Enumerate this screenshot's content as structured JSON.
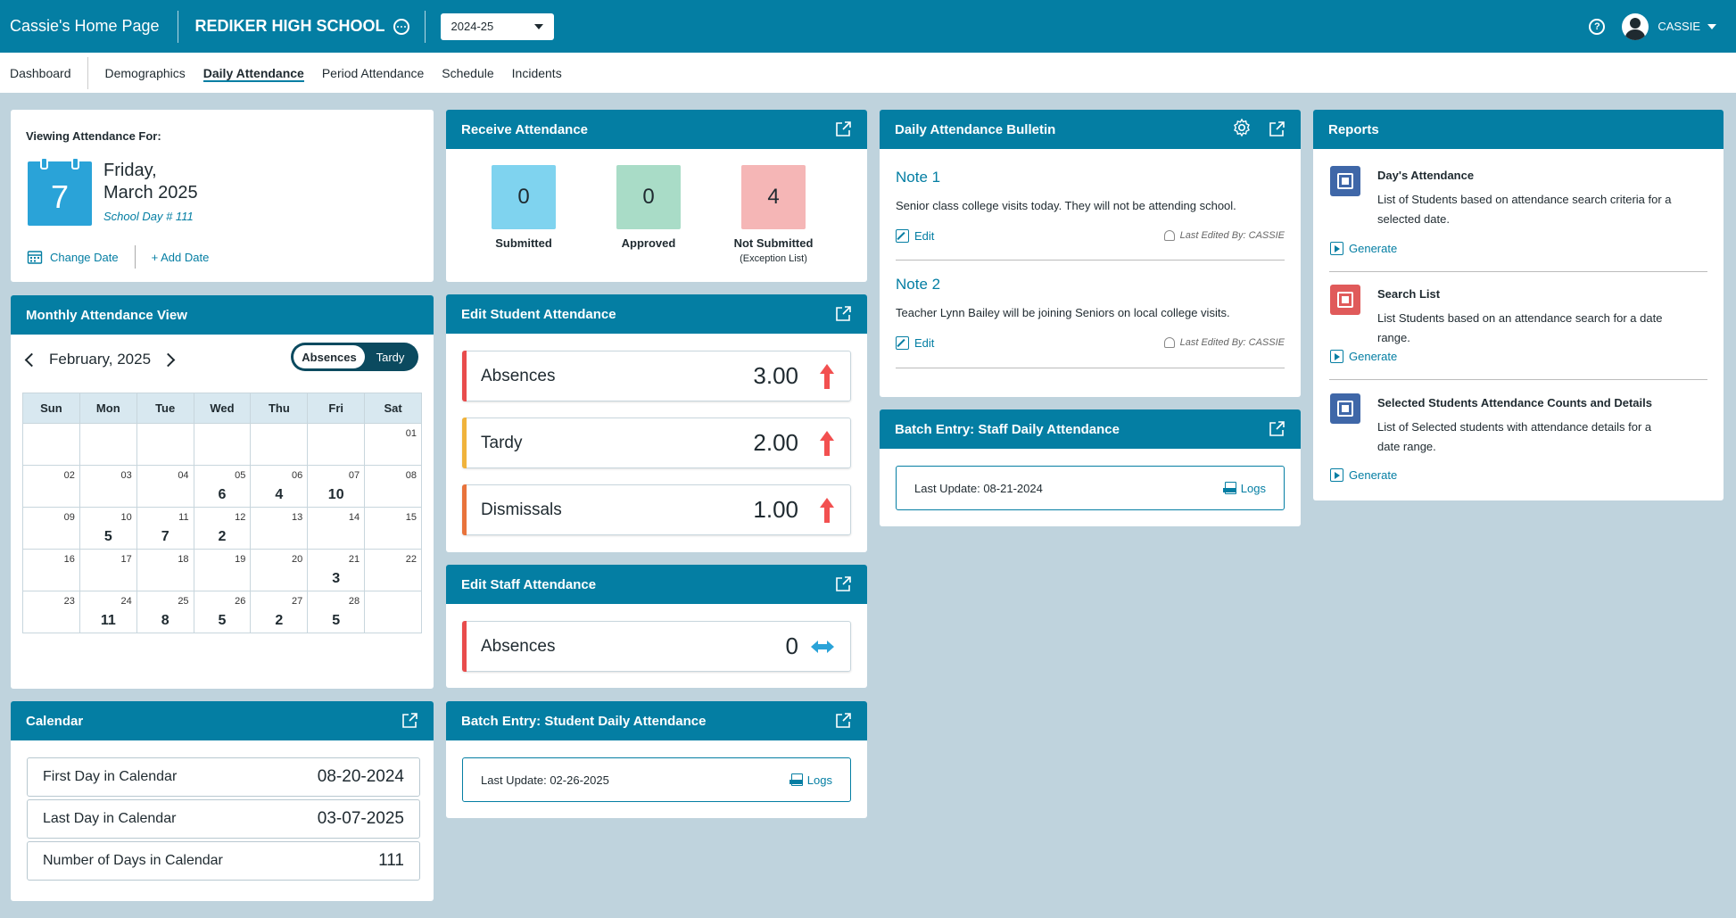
{
  "topbar": {
    "home_label": "Cassie's Home Page",
    "school_name": "REDIKER HIGH SCHOOL",
    "year": "2024-25",
    "username": "CASSIE"
  },
  "subnav": [
    "Dashboard",
    "Demographics",
    "Daily Attendance",
    "Period Attendance",
    "Schedule",
    "Incidents"
  ],
  "viewing": {
    "title": "Viewing Attendance For:",
    "day": "7",
    "weekday": "Friday,",
    "month_year": "March 2025",
    "school_day": "School Day # 111",
    "change_date": "Change Date",
    "add_date": "+ Add Date"
  },
  "monthly": {
    "title": "Monthly Attendance View",
    "month": "February, 2025",
    "toggle_on": "Absences",
    "toggle_off": "Tardy",
    "weekdays": [
      "Sun",
      "Mon",
      "Tue",
      "Wed",
      "Thu",
      "Fri",
      "Sat"
    ],
    "weeks": [
      [
        {
          "d": "",
          "c": ""
        },
        {
          "d": "",
          "c": ""
        },
        {
          "d": "",
          "c": ""
        },
        {
          "d": "",
          "c": ""
        },
        {
          "d": "",
          "c": ""
        },
        {
          "d": "",
          "c": ""
        },
        {
          "d": "01",
          "c": ""
        }
      ],
      [
        {
          "d": "02",
          "c": ""
        },
        {
          "d": "03",
          "c": ""
        },
        {
          "d": "04",
          "c": ""
        },
        {
          "d": "05",
          "c": "6"
        },
        {
          "d": "06",
          "c": "4"
        },
        {
          "d": "07",
          "c": "10"
        },
        {
          "d": "08",
          "c": ""
        }
      ],
      [
        {
          "d": "09",
          "c": ""
        },
        {
          "d": "10",
          "c": "5"
        },
        {
          "d": "11",
          "c": "7"
        },
        {
          "d": "12",
          "c": "2"
        },
        {
          "d": "13",
          "c": ""
        },
        {
          "d": "14",
          "c": ""
        },
        {
          "d": "15",
          "c": ""
        }
      ],
      [
        {
          "d": "16",
          "c": ""
        },
        {
          "d": "17",
          "c": ""
        },
        {
          "d": "18",
          "c": ""
        },
        {
          "d": "19",
          "c": ""
        },
        {
          "d": "20",
          "c": ""
        },
        {
          "d": "21",
          "c": "3"
        },
        {
          "d": "22",
          "c": ""
        }
      ],
      [
        {
          "d": "23",
          "c": ""
        },
        {
          "d": "24",
          "c": "11"
        },
        {
          "d": "25",
          "c": "8"
        },
        {
          "d": "26",
          "c": "5"
        },
        {
          "d": "27",
          "c": "2"
        },
        {
          "d": "28",
          "c": "5"
        },
        {
          "d": "",
          "c": ""
        }
      ]
    ]
  },
  "calendar": {
    "title": "Calendar",
    "rows": [
      {
        "label": "First Day in Calendar",
        "value": "08-20-2024"
      },
      {
        "label": "Last Day in Calendar",
        "value": "03-07-2025"
      },
      {
        "label": "Number of Days in Calendar",
        "value": "111"
      }
    ]
  },
  "receive": {
    "title": "Receive Attendance",
    "items": [
      {
        "count": "0",
        "label": "Submitted",
        "sub": "",
        "color": "#7fd3ef"
      },
      {
        "count": "0",
        "label": "Approved",
        "sub": "",
        "color": "#a9dcc7"
      },
      {
        "count": "4",
        "label": "Not Submitted",
        "sub": "(Exception List)",
        "color": "#f5b6b6"
      }
    ]
  },
  "edit_student": {
    "title": "Edit Student Attendance",
    "rows": [
      {
        "label": "Absences",
        "value": "3.00",
        "color": "#e84c4c"
      },
      {
        "label": "Tardy",
        "value": "2.00",
        "color": "#f0b33c"
      },
      {
        "label": "Dismissals",
        "value": "1.00",
        "color": "#e8733c"
      }
    ]
  },
  "edit_staff": {
    "title": "Edit Staff Attendance",
    "rows": [
      {
        "label": "Absences",
        "value": "0",
        "color": "#e84c4c"
      }
    ]
  },
  "batch_student": {
    "title": "Batch Entry: Student Daily Attendance",
    "last_update": "Last Update: 02-26-2025",
    "logs": "Logs"
  },
  "bulletin": {
    "title": "Daily Attendance Bulletin",
    "notes": [
      {
        "title": "Note 1",
        "text": "Senior class college visits today. They will not be attending school.",
        "edit": "Edit",
        "by": "Last Edited By: CASSIE"
      },
      {
        "title": "Note 2",
        "text": "Teacher Lynn Bailey will be joining Seniors on local college visits.",
        "edit": "Edit",
        "by": "Last Edited By: CASSIE"
      }
    ]
  },
  "batch_staff": {
    "title": "Batch Entry: Staff Daily Attendance",
    "last_update": "Last Update: 08-21-2024",
    "logs": "Logs"
  },
  "reports": {
    "title": "Reports",
    "items": [
      {
        "title": "Day's Attendance",
        "desc": "List of Students based on attendance search criteria for a selected date.",
        "generate": "Generate",
        "color": "#3f67a8"
      },
      {
        "title": "Search List",
        "desc": "List Students based on an attendance search for a date range.",
        "generate": "Generate",
        "color": "#e05a5a"
      },
      {
        "title": "Selected Students Attendance Counts and Details",
        "desc": "List of Selected students with attendance details for a date range.",
        "generate": "Generate",
        "color": "#3f67a8"
      }
    ]
  },
  "colors": {
    "brand": "#047ea3",
    "up_arrow": "#f25050",
    "lr_arrow": "#2aa3d8"
  }
}
